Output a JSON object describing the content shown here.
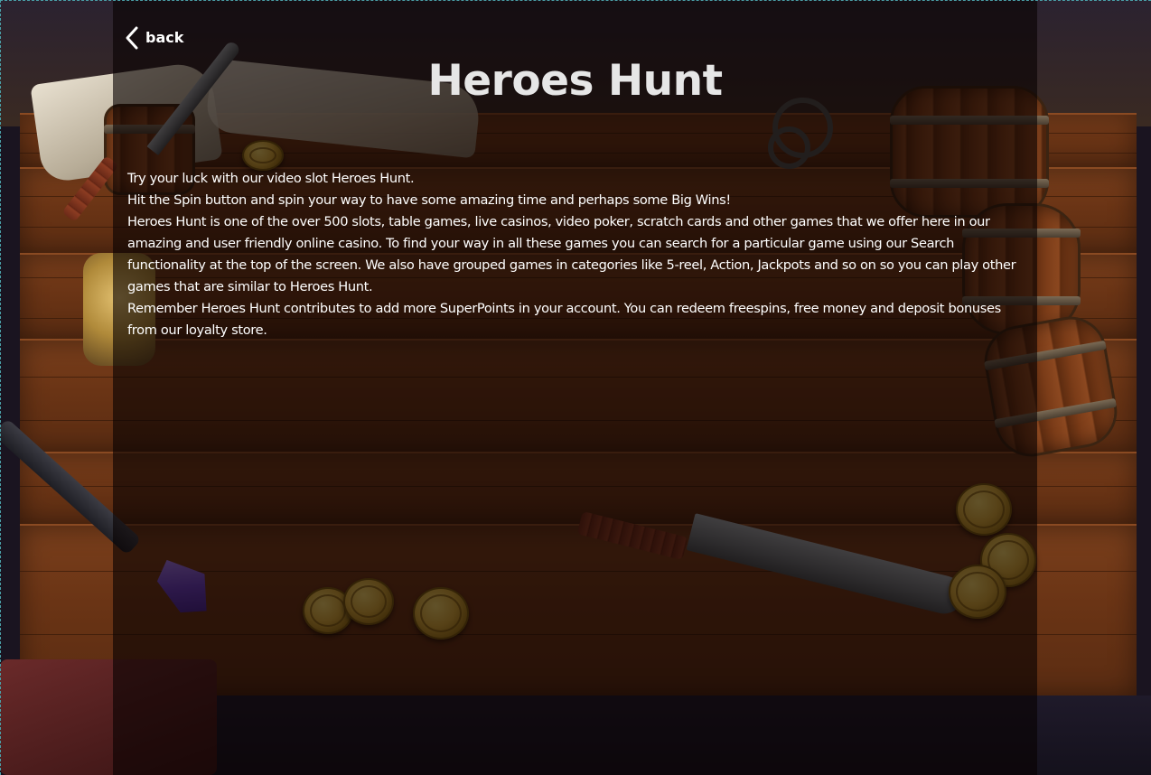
{
  "nav": {
    "back_label": "back",
    "back_icon": "chevron-left-icon"
  },
  "game": {
    "title": "Heroes Hunt",
    "description": [
      "Try your luck with our video slot Heroes Hunt.",
      "Hit the Spin button and spin your way to have some amazing time and perhaps some Big Wins!",
      "Heroes Hunt is one of the over 500 slots, table games, live casinos, video poker, scratch cards and other games that we offer here in our amazing and user friendly online casino. To find your way in all these games you can search for a particular game using our Search functionality at the top of the screen. We also have grouped games in categories like 5-reel, Action, Jackpots and so on so you can play other games that are similar to Heroes Hunt.",
      "Remember Heroes Hunt contributes to add more SuperPoints in your account. You can redeem freespins, free money and deposit bonuses from our loyalty store."
    ]
  },
  "colors": {
    "overlay": "#080202",
    "title_text": "#e6e6e6",
    "body_text": "#ffffff",
    "wood": "#6a3415"
  }
}
